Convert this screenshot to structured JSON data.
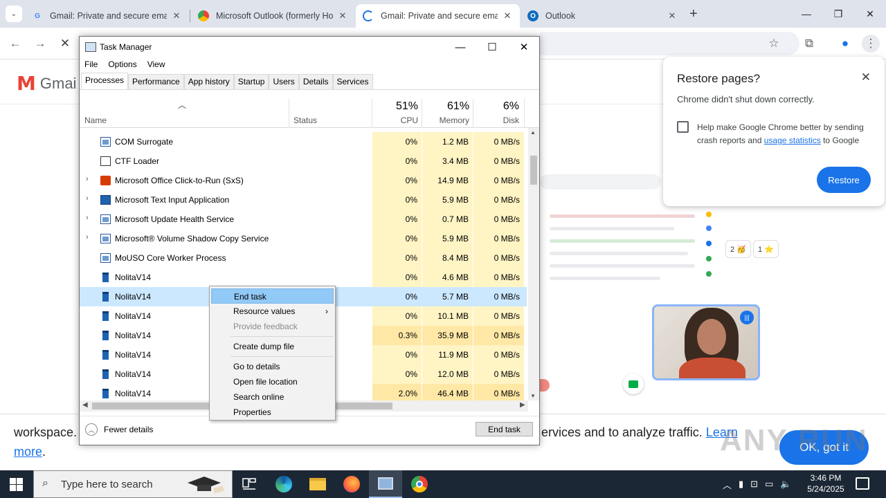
{
  "browser": {
    "tabs": [
      {
        "title": "Gmail: Private and secure email",
        "icon": "google-g-icon",
        "active": false
      },
      {
        "title": "Microsoft Outlook (formerly Ho",
        "icon": "chrome-icon",
        "active": false
      },
      {
        "title": "Gmail: Private and secure email",
        "icon": "loading-icon",
        "active": true
      },
      {
        "title": "Outlook",
        "icon": "outlook-icon",
        "active": false
      }
    ],
    "new_tab": "+",
    "close_glyph": "✕"
  },
  "gmail": {
    "logo_text": "Gmai",
    "cookie_text_left": "workspace.",
    "cookie_text_right": "ervices and to analyze traffic.",
    "cookie_link": "Learn",
    "cookie_more": "more",
    "cookie_more_dot": ".",
    "ok_button": "OK, got it",
    "reactions": [
      "2 🥳",
      "1 ⭐"
    ],
    "watermark": "ANY RUN"
  },
  "restore": {
    "title": "Restore pages?",
    "message": "Chrome didn't shut down correctly.",
    "checkbox_text": "Help make Google Chrome better by sending crash reports and ",
    "checkbox_link": "usage statistics",
    "checkbox_text_end": " to Google",
    "button": "Restore",
    "close": "✕"
  },
  "task_manager": {
    "title": "Task Manager",
    "menu": [
      "File",
      "Options",
      "View"
    ],
    "tabs": [
      "Processes",
      "Performance",
      "App history",
      "Startup",
      "Users",
      "Details",
      "Services"
    ],
    "active_tab": "Processes",
    "columns": {
      "name": "Name",
      "status": "Status",
      "cpu": {
        "pct": "51%",
        "label": "CPU"
      },
      "memory": {
        "pct": "61%",
        "label": "Memory"
      },
      "disk": {
        "pct": "6%",
        "label": "Disk"
      }
    },
    "processes": [
      {
        "name": "COM Surrogate",
        "cpu": "0%",
        "mem": "1.2 MB",
        "disk": "0 MB/s",
        "expand": false,
        "icon": "svc"
      },
      {
        "name": "CTF Loader",
        "cpu": "0%",
        "mem": "3.4 MB",
        "disk": "0 MB/s",
        "expand": false,
        "icon": "ctf"
      },
      {
        "name": "Microsoft Office Click-to-Run (SxS)",
        "cpu": "0%",
        "mem": "14.9 MB",
        "disk": "0 MB/s",
        "expand": true,
        "icon": "office"
      },
      {
        "name": "Microsoft Text Input Application",
        "cpu": "0%",
        "mem": "5.9 MB",
        "disk": "0 MB/s",
        "expand": true,
        "icon": "app"
      },
      {
        "name": "Microsoft Update Health Service",
        "cpu": "0%",
        "mem": "0.7 MB",
        "disk": "0 MB/s",
        "expand": true,
        "icon": "svc"
      },
      {
        "name": "Microsoft® Volume Shadow Copy Service",
        "cpu": "0%",
        "mem": "5.9 MB",
        "disk": "0 MB/s",
        "expand": true,
        "icon": "svc"
      },
      {
        "name": "MoUSO Core Worker Process",
        "cpu": "0%",
        "mem": "8.4 MB",
        "disk": "0 MB/s",
        "expand": false,
        "icon": "svc"
      },
      {
        "name": "NolitaV14",
        "cpu": "0%",
        "mem": "4.6 MB",
        "disk": "0 MB/s",
        "expand": false,
        "icon": "nol"
      },
      {
        "name": "NolitaV14",
        "cpu": "0%",
        "mem": "5.7 MB",
        "disk": "0 MB/s",
        "expand": false,
        "icon": "nol",
        "selected": true
      },
      {
        "name": "NolitaV14",
        "cpu": "0%",
        "mem": "10.1 MB",
        "disk": "0 MB/s",
        "expand": false,
        "icon": "nol"
      },
      {
        "name": "NolitaV14",
        "cpu": "0.3%",
        "mem": "35.9 MB",
        "disk": "0 MB/s",
        "expand": false,
        "icon": "nol",
        "hot": true
      },
      {
        "name": "NolitaV14",
        "cpu": "0%",
        "mem": "11.9 MB",
        "disk": "0 MB/s",
        "expand": false,
        "icon": "nol"
      },
      {
        "name": "NolitaV14",
        "cpu": "0%",
        "mem": "12.0 MB",
        "disk": "0 MB/s",
        "expand": false,
        "icon": "nol"
      },
      {
        "name": "NolitaV14",
        "cpu": "2.0%",
        "mem": "46.4 MB",
        "disk": "0 MB/s",
        "expand": false,
        "icon": "nol",
        "hot": true
      }
    ],
    "fewer_details": "Fewer details",
    "end_task": "End task",
    "context_menu": [
      {
        "label": "End task",
        "highlight": true
      },
      {
        "label": "Resource values",
        "submenu": true
      },
      {
        "label": "Provide feedback",
        "disabled": true
      },
      {
        "separator": true
      },
      {
        "label": "Create dump file"
      },
      {
        "separator": true
      },
      {
        "label": "Go to details"
      },
      {
        "label": "Open file location"
      },
      {
        "label": "Search online"
      },
      {
        "label": "Properties"
      }
    ]
  },
  "taskbar": {
    "search_placeholder": "Type here to search",
    "time": "3:46 PM",
    "date": "5/24/2025"
  },
  "colors": {
    "chrome_blue": "#1a73e8",
    "tm_heat": "#fff4c4",
    "tm_selected": "#cce8ff",
    "taskbar": "#1c2735"
  }
}
